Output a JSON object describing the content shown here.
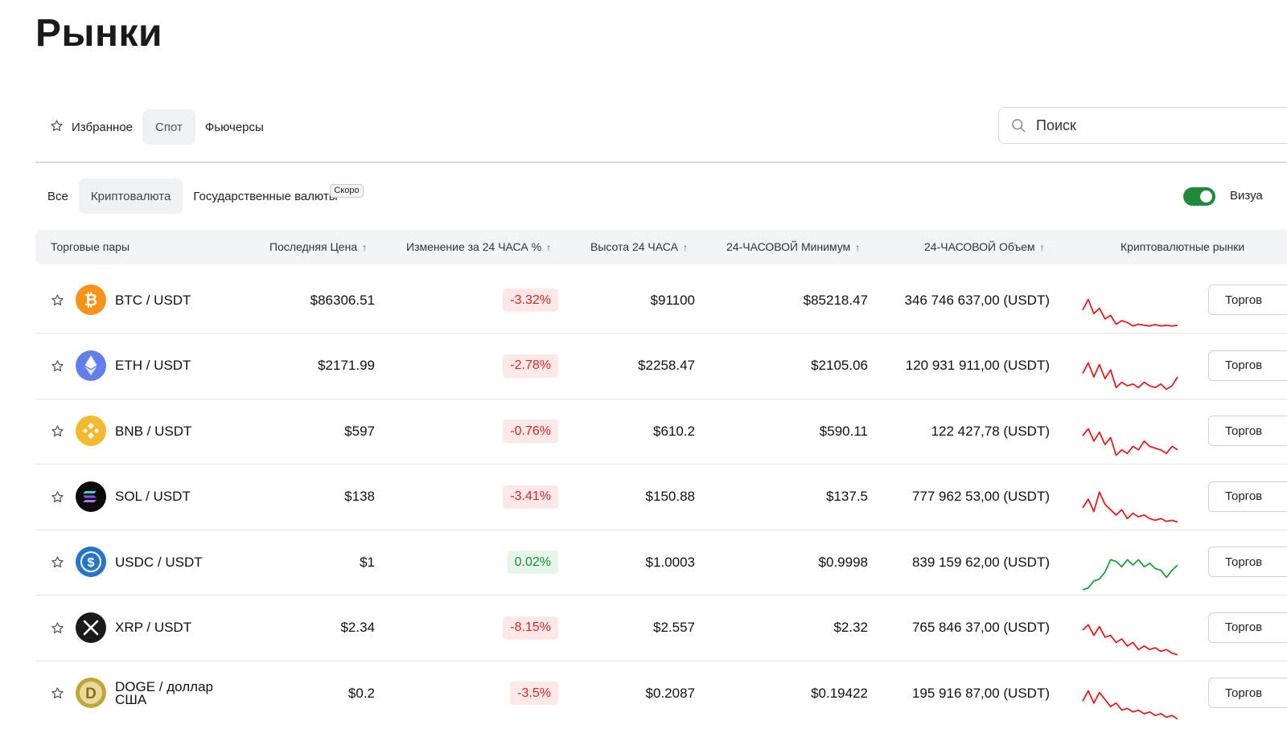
{
  "page": {
    "title": "Рынки"
  },
  "tabs": [
    {
      "label": "Избранное",
      "icon": "star-icon"
    },
    {
      "label": "Спот",
      "active": true
    },
    {
      "label": "Фьючерсы"
    }
  ],
  "search": {
    "placeholder": "Поиск",
    "icon": "search-icon"
  },
  "subtabs": [
    {
      "label": "Все"
    },
    {
      "label": "Криптовалюта",
      "active": true
    },
    {
      "label": "Государственные валюты",
      "badge": "Скоро"
    }
  ],
  "toggle": {
    "label": "Визуа",
    "on": true,
    "color": "#1f8a3a"
  },
  "table": {
    "headers": {
      "pair": "Торговые пары",
      "last_price": "Последняя Цена",
      "change": "Изменение за 24 ЧАСА %",
      "high": "Высота 24 ЧАСА",
      "low": "24-ЧАСОВОЙ Минимум",
      "volume": "24-ЧАСОВОЙ Объем",
      "markets": "Криптовалютные рынки",
      "sort_arrow": "↑"
    },
    "trade_label": "Торгов",
    "rows": [
      {
        "pair": "BTC / USDT",
        "icon": "bitcoin-icon",
        "color": "#f7931a",
        "price": "$86306.51",
        "change": "-3.32%",
        "direction": "down",
        "high": "$91100",
        "low": "$85218.47",
        "volume": "346 746 637,00 (USDT)",
        "spark": [
          0.55,
          0.85,
          0.45,
          0.6,
          0.3,
          0.4,
          0.15,
          0.25,
          0.2,
          0.1,
          0.15,
          0.12,
          0.1,
          0.14,
          0.1,
          0.12,
          0.1,
          0.12
        ]
      },
      {
        "pair": "ETH / USDT",
        "icon": "ethereum-icon",
        "color": "#627eea",
        "price": "$2171.99",
        "change": "-2.78%",
        "direction": "down",
        "high": "$2258.47",
        "low": "$2105.06",
        "volume": "120 931 911,00 (USDT)",
        "spark": [
          0.6,
          0.9,
          0.5,
          0.85,
          0.45,
          0.7,
          0.2,
          0.35,
          0.25,
          0.3,
          0.2,
          0.35,
          0.25,
          0.2,
          0.3,
          0.15,
          0.25,
          0.5
        ]
      },
      {
        "pair": "BNB / USDT",
        "icon": "bnb-icon",
        "color": "#f3ba2f",
        "price": "$597",
        "change": "-0.76%",
        "direction": "down",
        "high": "$610.2",
        "low": "$590.11",
        "volume": "122 427,78 (USDT)",
        "spark": [
          0.7,
          0.9,
          0.55,
          0.8,
          0.45,
          0.65,
          0.15,
          0.3,
          0.2,
          0.4,
          0.3,
          0.55,
          0.4,
          0.35,
          0.3,
          0.2,
          0.4,
          0.3
        ]
      },
      {
        "pair": "SOL / USDT",
        "icon": "solana-icon",
        "color": "#111111",
        "price": "$138",
        "change": "-3.41%",
        "direction": "down",
        "high": "$150.88",
        "low": "$137.5",
        "volume": "777 962 53,00 (USDT)",
        "spark": [
          0.5,
          0.75,
          0.4,
          0.95,
          0.6,
          0.45,
          0.3,
          0.45,
          0.2,
          0.35,
          0.25,
          0.3,
          0.2,
          0.15,
          0.2,
          0.12,
          0.15,
          0.1
        ]
      },
      {
        "pair": "USDC / USDT",
        "icon": "usdc-icon",
        "color": "#2775ca",
        "price": "$1",
        "change": "0.02%",
        "direction": "up",
        "high": "$1.0003",
        "low": "$0.9998",
        "volume": "839 159 62,00 (USDT)",
        "spark": [
          0.05,
          0.1,
          0.3,
          0.35,
          0.55,
          0.9,
          0.85,
          0.7,
          0.9,
          0.75,
          0.9,
          0.7,
          0.8,
          0.65,
          0.6,
          0.4,
          0.6,
          0.75
        ]
      },
      {
        "pair": "XRP / USDT",
        "icon": "xrp-icon",
        "color": "#1a1a1a",
        "price": "$2.34",
        "change": "-8.15%",
        "direction": "down",
        "high": "$2.557",
        "low": "$2.32",
        "volume": "765 846 37,00 (USDT)",
        "spark": [
          0.75,
          0.9,
          0.6,
          0.85,
          0.55,
          0.6,
          0.4,
          0.5,
          0.3,
          0.4,
          0.2,
          0.3,
          0.2,
          0.25,
          0.15,
          0.2,
          0.1,
          0.05
        ]
      },
      {
        "pair": "DOGE / доллар США",
        "icon": "dogecoin-icon",
        "color": "#c2a633",
        "price": "$0.2",
        "change": "-3.5%",
        "direction": "down",
        "high": "$0.2087",
        "low": "$0.19422",
        "volume": "195 916 87,00 (USDT)",
        "spark": [
          0.6,
          0.9,
          0.55,
          0.85,
          0.65,
          0.45,
          0.55,
          0.35,
          0.4,
          0.3,
          0.35,
          0.25,
          0.3,
          0.2,
          0.25,
          0.15,
          0.2,
          0.1
        ]
      }
    ]
  },
  "colors": {
    "down": "#e01e1e",
    "up": "#16a33a",
    "accent_toggle": "#1f8a3a"
  }
}
